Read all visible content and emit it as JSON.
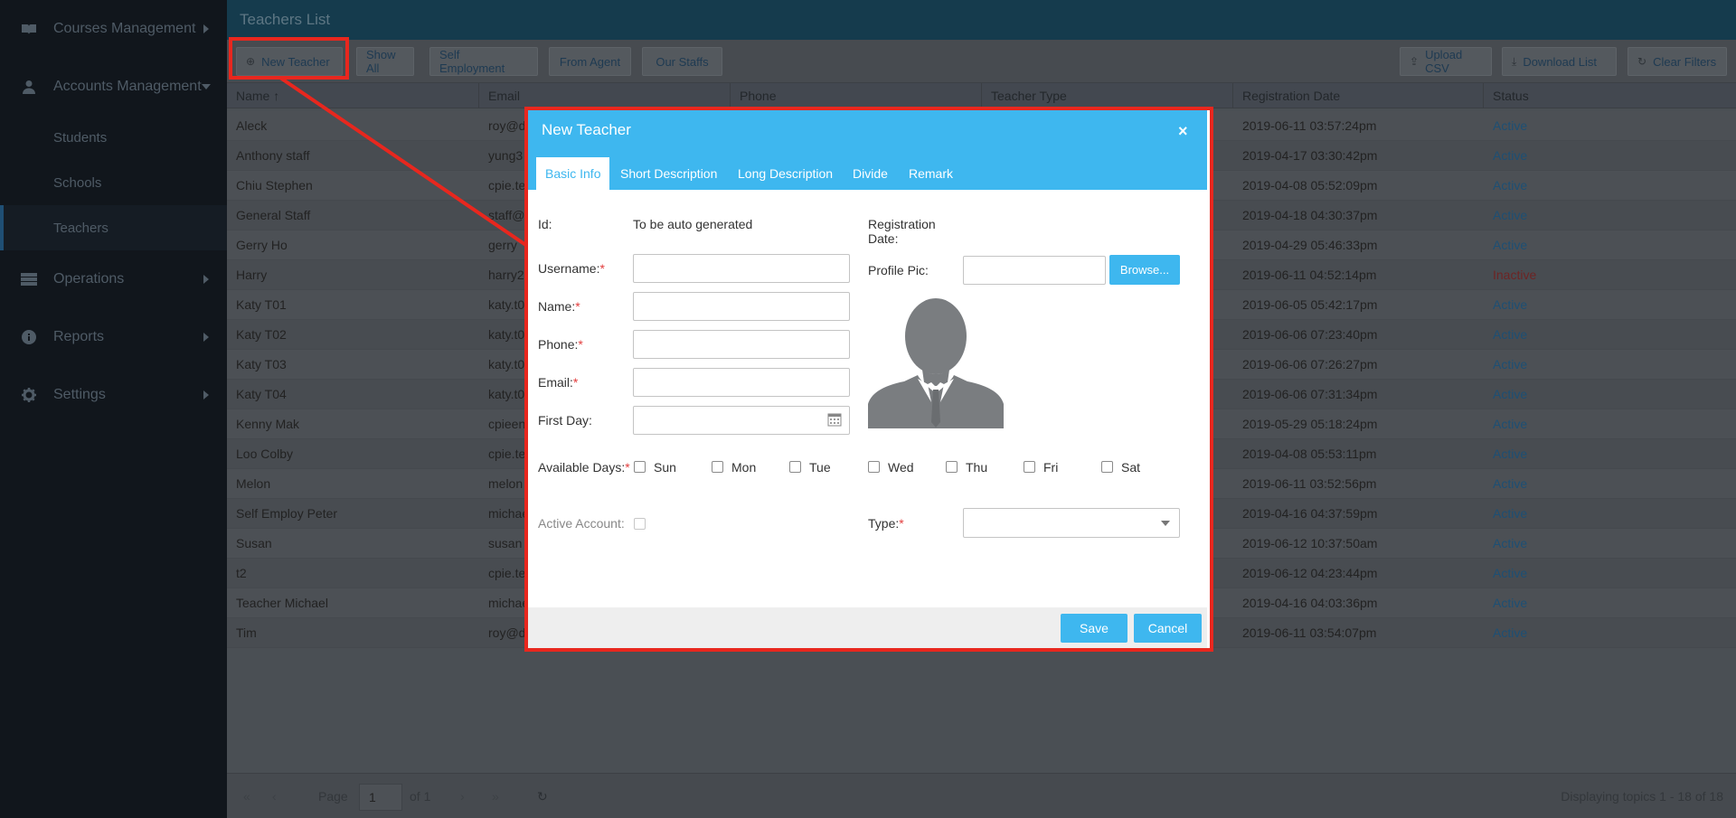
{
  "sidebar": {
    "courses": "Courses Management",
    "accounts": "Accounts Management",
    "students": "Students",
    "schools": "Schools",
    "teachers": "Teachers",
    "operations": "Operations",
    "reports": "Reports",
    "settings": "Settings"
  },
  "page": {
    "title": "Teachers List"
  },
  "toolbar": {
    "new_teacher": "New Teacher",
    "show_all": "Show All",
    "self_employment": "Self Employment",
    "from_agent": "From Agent",
    "our_staffs": "Our Staffs",
    "upload_csv": "Upload CSV",
    "download_list": "Download List",
    "clear_filters": "Clear Filters"
  },
  "grid": {
    "columns": {
      "name": "Name",
      "email": "Email",
      "phone": "Phone",
      "type": "Teacher Type",
      "registration": "Registration Date",
      "status": "Status"
    },
    "rows": [
      {
        "name": "Aleck",
        "email": "roy@d",
        "date": "2019-06-11 03:57:24pm",
        "status": "Active"
      },
      {
        "name": "Anthony staff",
        "email": "yung3",
        "date": "2019-04-17 03:30:42pm",
        "status": "Active"
      },
      {
        "name": "Chiu Stephen",
        "email": "cpie.te",
        "date": "2019-04-08 05:52:09pm",
        "status": "Active"
      },
      {
        "name": "General Staff",
        "email": "staff@",
        "date": "2019-04-18 04:30:37pm",
        "status": "Active"
      },
      {
        "name": "Gerry Ho",
        "email": "gerry",
        "date": "2019-04-29 05:46:33pm",
        "status": "Active"
      },
      {
        "name": "Harry",
        "email": "harry2",
        "date": "2019-06-11 04:52:14pm",
        "status": "Inactive"
      },
      {
        "name": "Katy T01",
        "email": "katy.t0",
        "date": "2019-06-05 05:42:17pm",
        "status": "Active"
      },
      {
        "name": "Katy T02",
        "email": "katy.t0",
        "date": "2019-06-06 07:23:40pm",
        "status": "Active"
      },
      {
        "name": "Katy T03",
        "email": "katy.t0",
        "date": "2019-06-06 07:26:27pm",
        "status": "Active"
      },
      {
        "name": "Katy T04",
        "email": "katy.t0",
        "date": "2019-06-06 07:31:34pm",
        "status": "Active"
      },
      {
        "name": "Kenny Mak",
        "email": "cpieen",
        "date": "2019-05-29 05:18:24pm",
        "status": "Active"
      },
      {
        "name": "Loo Colby",
        "email": "cpie.te",
        "date": "2019-04-08 05:53:11pm",
        "status": "Active"
      },
      {
        "name": "Melon",
        "email": "melon",
        "date": "2019-06-11 03:52:56pm",
        "status": "Active"
      },
      {
        "name": "Self Employ Peter",
        "email": "michae",
        "date": "2019-04-16 04:37:59pm",
        "status": "Active"
      },
      {
        "name": "Susan",
        "email": "susan",
        "date": "2019-06-12 10:37:50am",
        "status": "Active"
      },
      {
        "name": "t2",
        "email": "cpie.te",
        "date": "2019-06-12 04:23:44pm",
        "status": "Active"
      },
      {
        "name": "Teacher Michael",
        "email": "michae",
        "date": "2019-04-16 04:03:36pm",
        "status": "Active"
      },
      {
        "name": "Tim",
        "email": "roy@d",
        "date": "2019-06-11 03:54:07pm",
        "status": "Active"
      }
    ]
  },
  "pager": {
    "page_label": "Page",
    "page_value": "1",
    "of_label": "of 1",
    "display_text": "Displaying topics 1 - 18 of 18"
  },
  "modal": {
    "title": "New Teacher",
    "close_glyph": "×",
    "tabs": [
      "Basic Info",
      "Short Description",
      "Long Description",
      "Divide",
      "Remark"
    ],
    "id_label": "Id:",
    "id_value": "To be auto generated",
    "username_label": "Username:",
    "name_label": "Name:",
    "phone_label": "Phone:",
    "email_label": "Email:",
    "firstday_label": "First Day:",
    "regdate_label_1": "Registration",
    "regdate_label_2": "Date:",
    "profile_label": "Profile Pic:",
    "browse": "Browse...",
    "available_days_label": "Available Days:",
    "days": [
      "Sun",
      "Mon",
      "Tue",
      "Wed",
      "Thu",
      "Fri",
      "Sat"
    ],
    "active_label": "Active Account:",
    "type_label": "Type:",
    "required_mark": "*",
    "save": "Save",
    "cancel": "Cancel"
  },
  "colors": {
    "accent": "#3eb7ef",
    "highlight": "#e8271e",
    "active_status": "#1d4f74",
    "inactive_status": "#6d2424"
  }
}
